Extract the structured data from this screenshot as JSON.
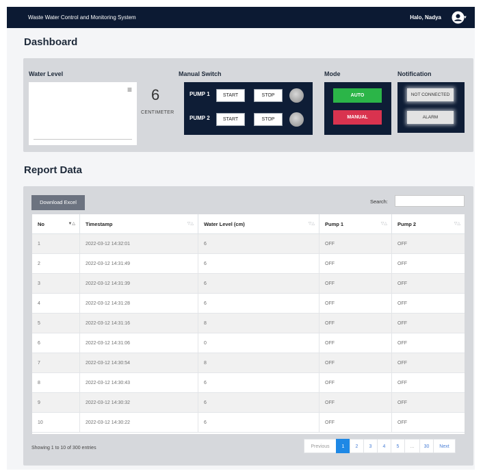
{
  "header": {
    "app_title": "Waste Water Control and Monitoring System",
    "user_greeting": "Halo, Nadya",
    "user_icon": "user-circle-icon"
  },
  "dashboard": {
    "title": "Dashboard",
    "water_level": {
      "label": "Water Level",
      "value": "6",
      "unit": "CENTIMETER",
      "chart_menu_icon": "hamburger-menu-icon"
    },
    "manual_switch": {
      "label": "Manual Switch",
      "pumps": [
        {
          "name": "PUMP 1",
          "start_label": "START",
          "stop_label": "STOP"
        },
        {
          "name": "PUMP 2",
          "start_label": "START",
          "stop_label": "STOP"
        }
      ]
    },
    "mode": {
      "label": "Mode",
      "auto_label": "AUTO",
      "manual_label": "MANUAL"
    },
    "notification": {
      "label": "Notification",
      "status": "NOT CONNECTED",
      "alarm": "ALARM"
    }
  },
  "report": {
    "title": "Report Data",
    "download_label": "Download Excel",
    "search_label": "Search:",
    "search_value": "",
    "columns": [
      "No",
      "Timestamp",
      "Water Level (cm)",
      "Pump 1",
      "Pump 2"
    ],
    "rows": [
      [
        "1",
        "2022-03-12 14:32:01",
        "6",
        "OFF",
        "OFF"
      ],
      [
        "2",
        "2022-03-12 14:31:49",
        "6",
        "OFF",
        "OFF"
      ],
      [
        "3",
        "2022-03-12 14:31:39",
        "6",
        "OFF",
        "OFF"
      ],
      [
        "4",
        "2022-03-12 14:31:28",
        "6",
        "OFF",
        "OFF"
      ],
      [
        "5",
        "2022-03-12 14:31:16",
        "8",
        "OFF",
        "OFF"
      ],
      [
        "6",
        "2022-03-12 14:31:06",
        "0",
        "OFF",
        "OFF"
      ],
      [
        "7",
        "2022-03-12 14:30:54",
        "8",
        "OFF",
        "OFF"
      ],
      [
        "8",
        "2022-03-12 14:30:43",
        "6",
        "OFF",
        "OFF"
      ],
      [
        "9",
        "2022-03-12 14:30:32",
        "6",
        "OFF",
        "OFF"
      ],
      [
        "10",
        "2022-03-12 14:30:22",
        "6",
        "OFF",
        "OFF"
      ]
    ],
    "entries_info": "Showing 1 to 10 of 300 entries",
    "pagination": [
      "Previous",
      "1",
      "2",
      "3",
      "4",
      "5",
      "...",
      "30",
      "Next"
    ],
    "active_page": "1"
  },
  "colors": {
    "topbar": "#0c1a33",
    "panel_dark": "#0e1d36",
    "auto_green": "#2bb548",
    "manual_red": "#d9334f",
    "page_active_blue": "#1e88e5"
  }
}
